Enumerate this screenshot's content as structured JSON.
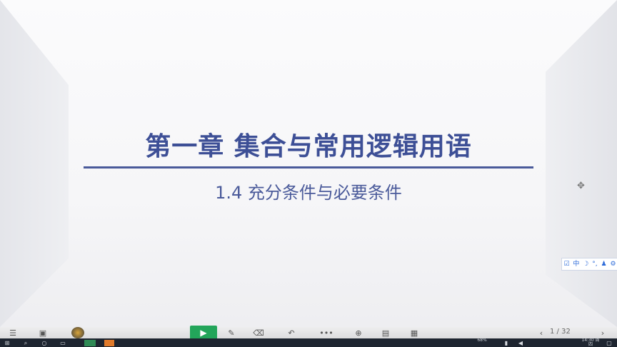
{
  "slide": {
    "title": "第一章  集合与常用逻辑用语",
    "subtitle": "1.4  充分条件与必要条件"
  },
  "ime_bar": {
    "items": [
      "中",
      "☽",
      "°,",
      "♟",
      "⚙"
    ]
  },
  "presentation_toolbar": {
    "play_icon": "▶",
    "page_indicator": "1 / 32",
    "prev_label": "‹",
    "next_label": "›"
  },
  "tray": {
    "battery": "68%",
    "time": "14:30 周四"
  },
  "colors": {
    "title": "#3d4f96",
    "rule": "#4a5a9a",
    "play_button": "#23a55a",
    "taskbar": "#1e2530"
  }
}
